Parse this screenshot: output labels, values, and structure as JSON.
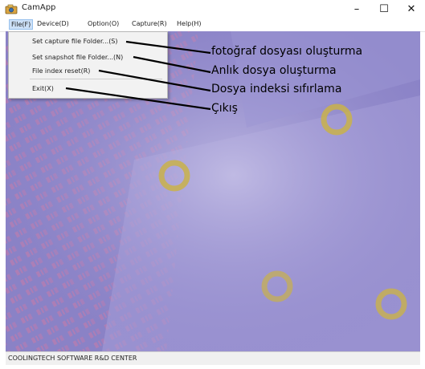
{
  "window": {
    "title": "CamApp",
    "icon": "camera-app-icon"
  },
  "window_controls": {
    "minimize": "–",
    "maximize": "☐",
    "close": "✕"
  },
  "menubar": {
    "items": [
      "File(F)",
      "Device(D)",
      "Option(O)",
      "Capture(R)",
      "Help(H)"
    ]
  },
  "file_menu": {
    "items": [
      "Set capture file Folder...(S)",
      "Set snapshot file Folder...(N)",
      "File index reset(R)",
      "Exit(X)"
    ]
  },
  "annotations": [
    "fotoğraf dosyası oluşturma",
    "Anlık dosya oluşturma",
    "Dosya indeksi sıfırlama",
    "Çıkış"
  ],
  "statusbar": {
    "text": "COOLINGTECH SOFTWARE R&D CENTER"
  },
  "colors": {
    "preview_purple": "#8f87cc",
    "menu_active": "#cce0f7",
    "dropdown_bg": "#f2f2f2",
    "ring_yellow": "#c9b14a"
  }
}
